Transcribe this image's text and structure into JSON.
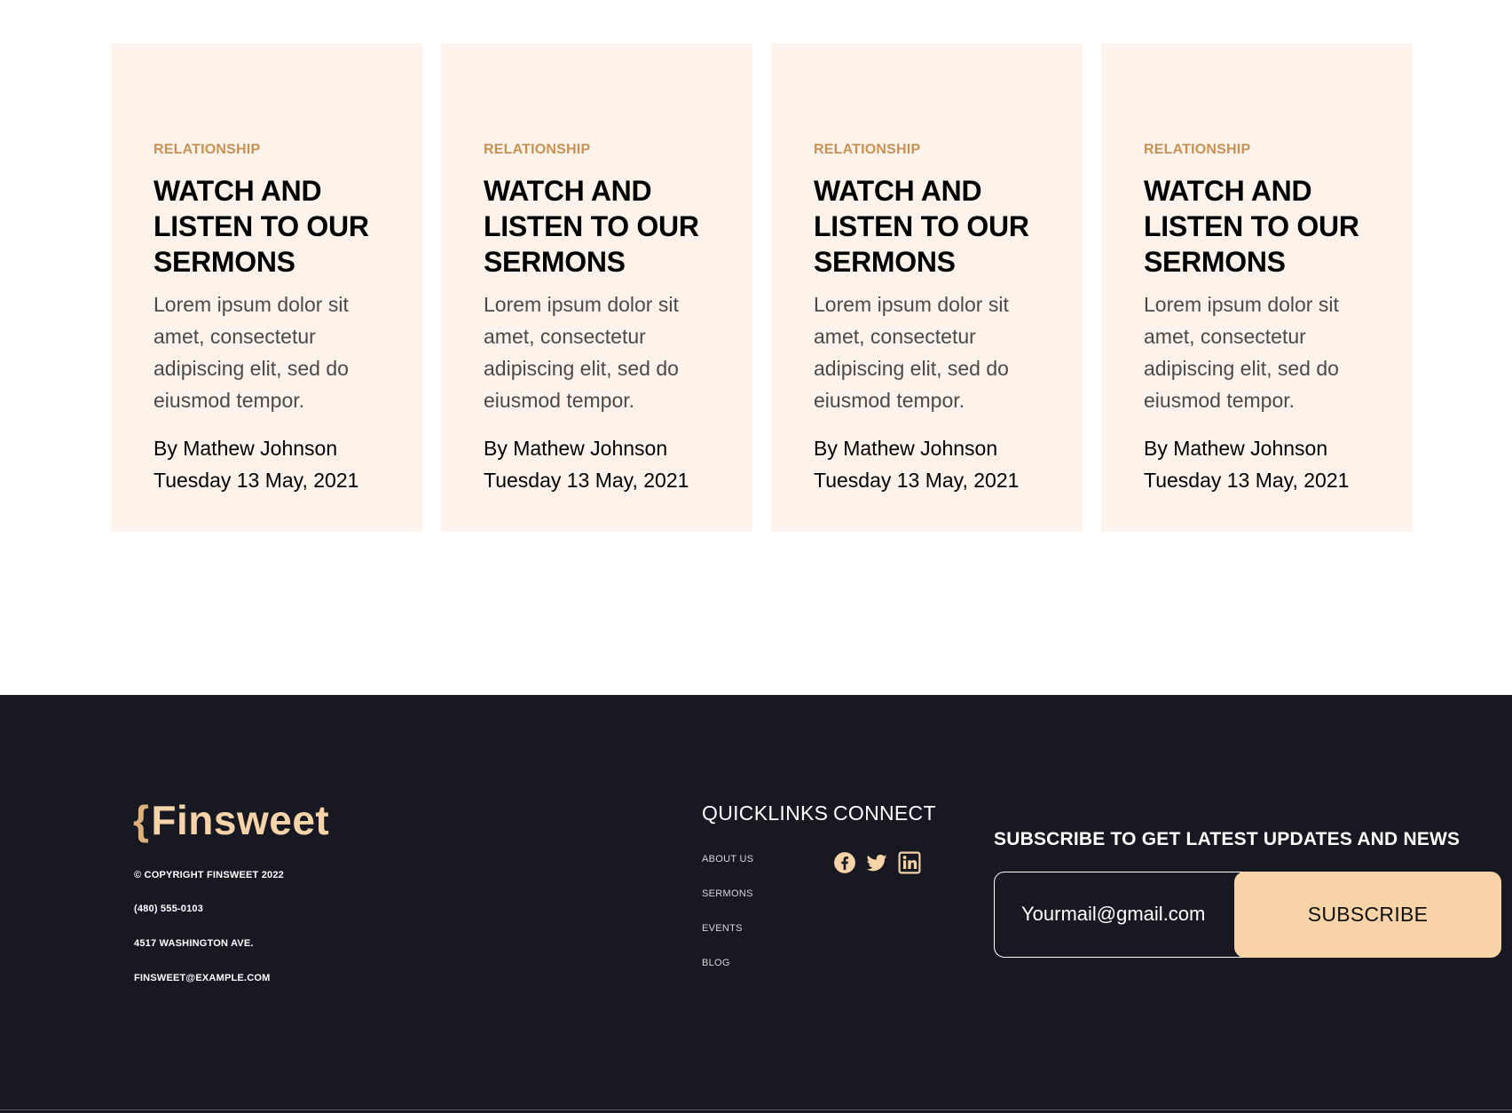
{
  "cards": [
    {
      "category": "RELATIONSHIP",
      "title": "WATCH AND LISTEN TO OUR SERMONS",
      "description": "Lorem ipsum dolor sit amet, consectetur adipiscing elit, sed do eiusmod tempor.",
      "author": "By Mathew Johnson",
      "date": "Tuesday 13 May, 2021"
    },
    {
      "category": "RELATIONSHIP",
      "title": "WATCH AND LISTEN TO OUR SERMONS",
      "description": "Lorem ipsum dolor sit amet, consectetur adipiscing elit, sed do eiusmod tempor.",
      "author": "By Mathew Johnson",
      "date": "Tuesday 13 May, 2021"
    },
    {
      "category": "RELATIONSHIP",
      "title": "WATCH AND LISTEN TO OUR SERMONS",
      "description": "Lorem ipsum dolor sit amet, consectetur adipiscing elit, sed do eiusmod tempor.",
      "author": "By Mathew Johnson",
      "date": "Tuesday 13 May, 2021"
    },
    {
      "category": "RELATIONSHIP",
      "title": "WATCH AND LISTEN TO OUR SERMONS",
      "description": "Lorem ipsum dolor sit amet, consectetur adipiscing elit, sed do eiusmod tempor.",
      "author": "By Mathew Johnson",
      "date": "Tuesday 13 May, 2021"
    }
  ],
  "footer": {
    "logo": {
      "brace": "{",
      "text": "Finsweet"
    },
    "copyright": "© COPYRIGHT FINSWEET 2022",
    "phone": "(480) 555-0103",
    "address": "4517 WASHINGTON AVE.",
    "email": "FINSWEET@EXAMPLE.COM",
    "quicklinks": {
      "heading": "QUICKLINKS",
      "links": [
        "ABOUT US",
        "SERMONS",
        "EVENTS",
        "BLOG"
      ]
    },
    "connect": {
      "heading": "CONNECT",
      "icons": [
        "facebook-icon",
        "twitter-icon",
        "linkedin-icon"
      ]
    },
    "subscribe": {
      "heading": "SUBSCRIBE TO GET LATEST UPDATES AND NEWS",
      "placeholder": "Yourmail@gmail.com",
      "button_label": "SUBSCRIBE"
    }
  },
  "colors": {
    "card_bg": "#fdf3ea",
    "category": "#c89257",
    "footer_bg": "#171821",
    "accent": "#f8d4a8"
  }
}
